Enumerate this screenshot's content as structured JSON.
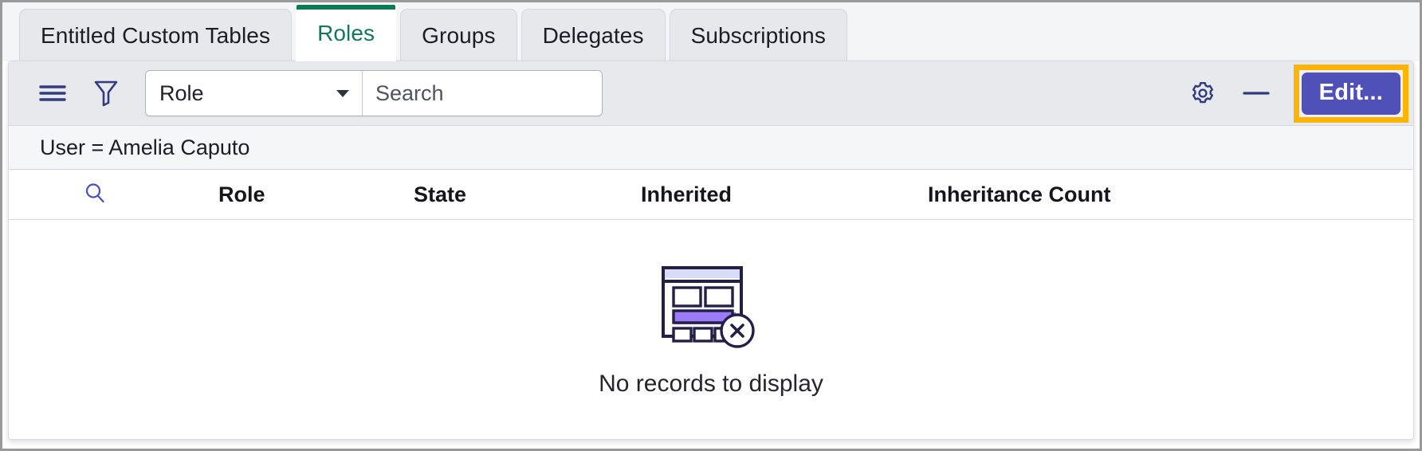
{
  "tabs": [
    {
      "label": "Entitled Custom Tables",
      "active": false
    },
    {
      "label": "Roles",
      "active": true
    },
    {
      "label": "Groups",
      "active": false
    },
    {
      "label": "Delegates",
      "active": false
    },
    {
      "label": "Subscriptions",
      "active": false
    }
  ],
  "toolbar": {
    "menu_icon": "hamburger-icon",
    "filter_icon": "funnel-filter-icon",
    "field_select_value": "Role",
    "search_value": "",
    "search_placeholder": "Search",
    "settings_icon": "gear-icon",
    "minimize_icon": "minus-icon",
    "edit_label": "Edit...",
    "edit_accent_color": "#5050b9",
    "highlight_color": "#ffb400"
  },
  "filter_summary": {
    "text": "User = Amelia Caputo"
  },
  "table": {
    "search_icon": "magnifier-icon",
    "columns": [
      {
        "label": "Role"
      },
      {
        "label": "State"
      },
      {
        "label": "Inherited"
      },
      {
        "label": "Inheritance Count"
      }
    ],
    "rows": [],
    "empty_state": {
      "icon": "no-records-table-icon",
      "message": "No records to display"
    }
  },
  "colors": {
    "active_tab_accent": "#0a7b54",
    "active_tab_text": "#12775c",
    "icon_indigo": "#343a80",
    "illustration_dark": "#231f47",
    "illustration_purple": "#9b7bf7",
    "illustration_lavender": "#d9dcf8"
  }
}
